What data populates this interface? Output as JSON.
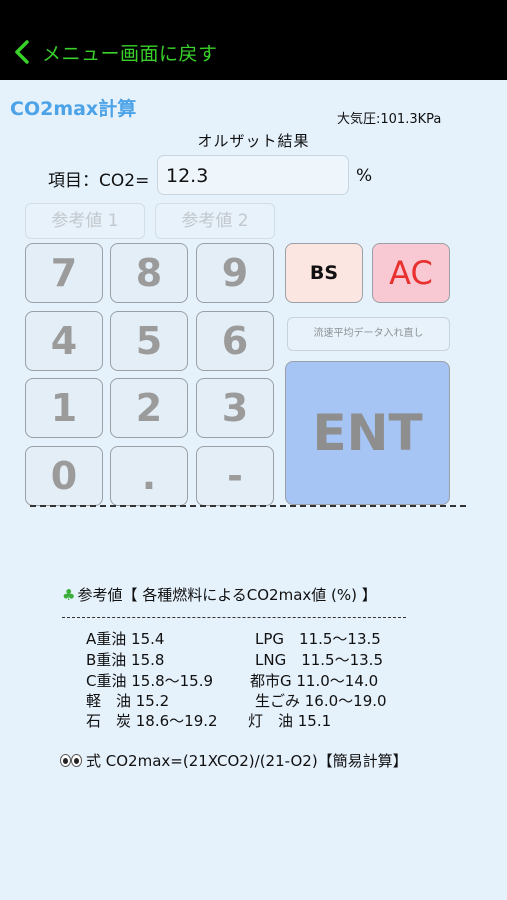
{
  "nav": {
    "back_label": "メニュー画面に戻す"
  },
  "title": "CO2max計算",
  "pressure": "大気圧:101.3KPa",
  "analysis_label": "オルザット結果",
  "item_label": "項目：CO2=",
  "input_value": "12.3",
  "unit": "%",
  "ref_buttons": [
    "参考値 1",
    "参考値 2"
  ],
  "keys": [
    "7",
    "8",
    "9",
    "4",
    "5",
    "6",
    "1",
    "2",
    "3",
    "0",
    ".",
    "-"
  ],
  "bs_label": "BS",
  "ac_label": "AC",
  "reenter_label": "流速平均データ入れ直し",
  "ent_label": "ENT",
  "reference": {
    "heading": "参考値【 各種燃料によるCO2max値 (%) 】",
    "left": [
      "A重油 15.4",
      "B重油 15.8",
      "C重油 15.8～15.9",
      "軽　油 15.2",
      "石　炭 18.6～19.2"
    ],
    "right": [
      "LPG　11.5～13.5",
      "LNG　11.5～13.5",
      "都市G 11.0～14.0",
      "生ごみ 16.0～19.0",
      "灯　油 15.1"
    ]
  },
  "formula": "式 CO2max=(21XCO2)/(21-O2)【簡易計算】",
  "colors": {
    "background": "#e5f1fb",
    "nav_bar": "#000000",
    "nav_text": "#39d12a",
    "title": "#4da3e8",
    "ent": "#a6c4f4",
    "bs": "#fce6e2",
    "ac": "#f9c9d3",
    "ac_text": "#e8302e"
  },
  "icons": [
    "chevron-left-icon",
    "clover-icon",
    "eyes-icon"
  ]
}
